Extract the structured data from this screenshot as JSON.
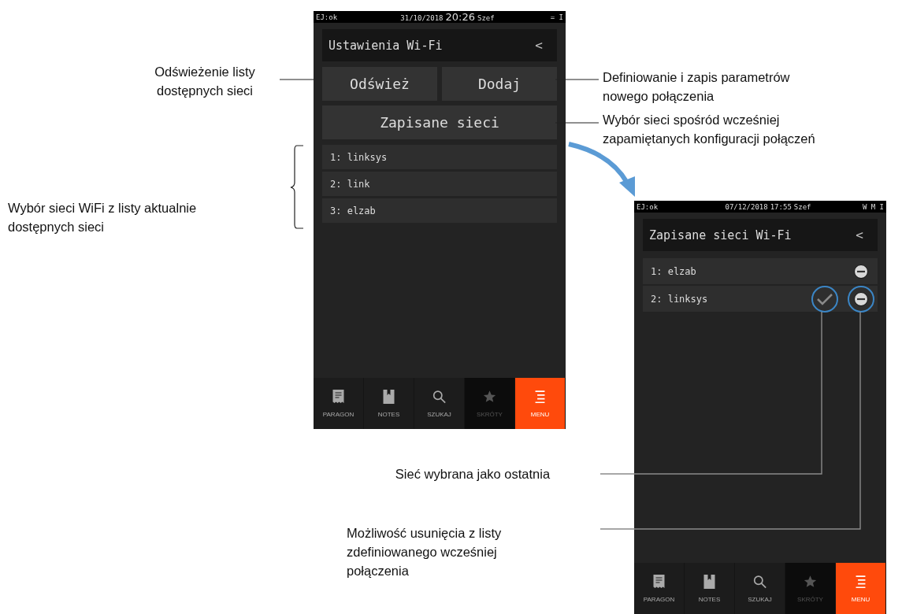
{
  "screens": [
    {
      "status_bar": {
        "left": "EJ:ok",
        "date": "31/10/2018",
        "time": "20:26",
        "user": "Szef",
        "right": "= I",
        "large_time": true
      },
      "title": "Ustawienia Wi-Fi",
      "back": "<",
      "buttons": [
        {
          "label": "Odśwież",
          "wide": false
        },
        {
          "label": "Dodaj",
          "wide": false
        },
        {
          "label": "Zapisane sieci",
          "wide": true
        }
      ],
      "networks": [
        {
          "label": "1: linksys",
          "kind": "available"
        },
        {
          "label": "2: link",
          "kind": "available"
        },
        {
          "label": "3: elzab",
          "kind": "available"
        }
      ],
      "nav": [
        {
          "label": "PARAGON",
          "kind": "receipt",
          "selected": false,
          "disabled": false
        },
        {
          "label": "NOTES",
          "kind": "notes",
          "selected": false,
          "disabled": false
        },
        {
          "label": "SZUKAJ",
          "kind": "search",
          "selected": false,
          "disabled": false
        },
        {
          "label": "SKRÓTY",
          "kind": "star",
          "selected": false,
          "disabled": true
        },
        {
          "label": "MENU",
          "kind": "menu",
          "selected": true,
          "disabled": false
        }
      ]
    },
    {
      "status_bar": {
        "left": "EJ:ok",
        "date": "07/12/2018",
        "time": "17:55",
        "user": "Szef",
        "right": "W M I",
        "large_time": false
      },
      "title": "Zapisane sieci Wi-Fi",
      "back": "<",
      "networks": [
        {
          "label": "1: elzab",
          "kind": "saved",
          "last_used": false,
          "highlighted": false
        },
        {
          "label": "2: linksys",
          "kind": "saved",
          "last_used": true,
          "highlighted": true
        }
      ],
      "nav": [
        {
          "label": "PARAGON",
          "kind": "receipt",
          "selected": false,
          "disabled": false
        },
        {
          "label": "NOTES",
          "kind": "notes",
          "selected": false,
          "disabled": false
        },
        {
          "label": "SZUKAJ",
          "kind": "search",
          "selected": false,
          "disabled": false
        },
        {
          "label": "SKRÓTY",
          "kind": "star",
          "selected": false,
          "disabled": true
        },
        {
          "label": "MENU",
          "kind": "menu",
          "selected": true,
          "disabled": false
        }
      ]
    }
  ],
  "annotations": [
    {
      "lines": [
        "Odświeżenie listy",
        "dostępnych sieci"
      ]
    },
    {
      "lines": [
        "Definiowanie i zapis parametrów",
        "nowego połączenia"
      ]
    },
    {
      "lines": [
        "Wybór sieci spośród wcześniej",
        "zapamiętanych konfiguracji połączeń"
      ]
    },
    {
      "lines": [
        "Wybór sieci WiFi z listy aktualnie",
        "dostępnych sieci"
      ]
    },
    {
      "lines": [
        "Sieć wybrana jako ostatnia"
      ]
    },
    {
      "lines": [
        "Możliwość usunięcia z listy",
        "zdefiniowanego wcześniej",
        "połączenia"
      ]
    }
  ]
}
